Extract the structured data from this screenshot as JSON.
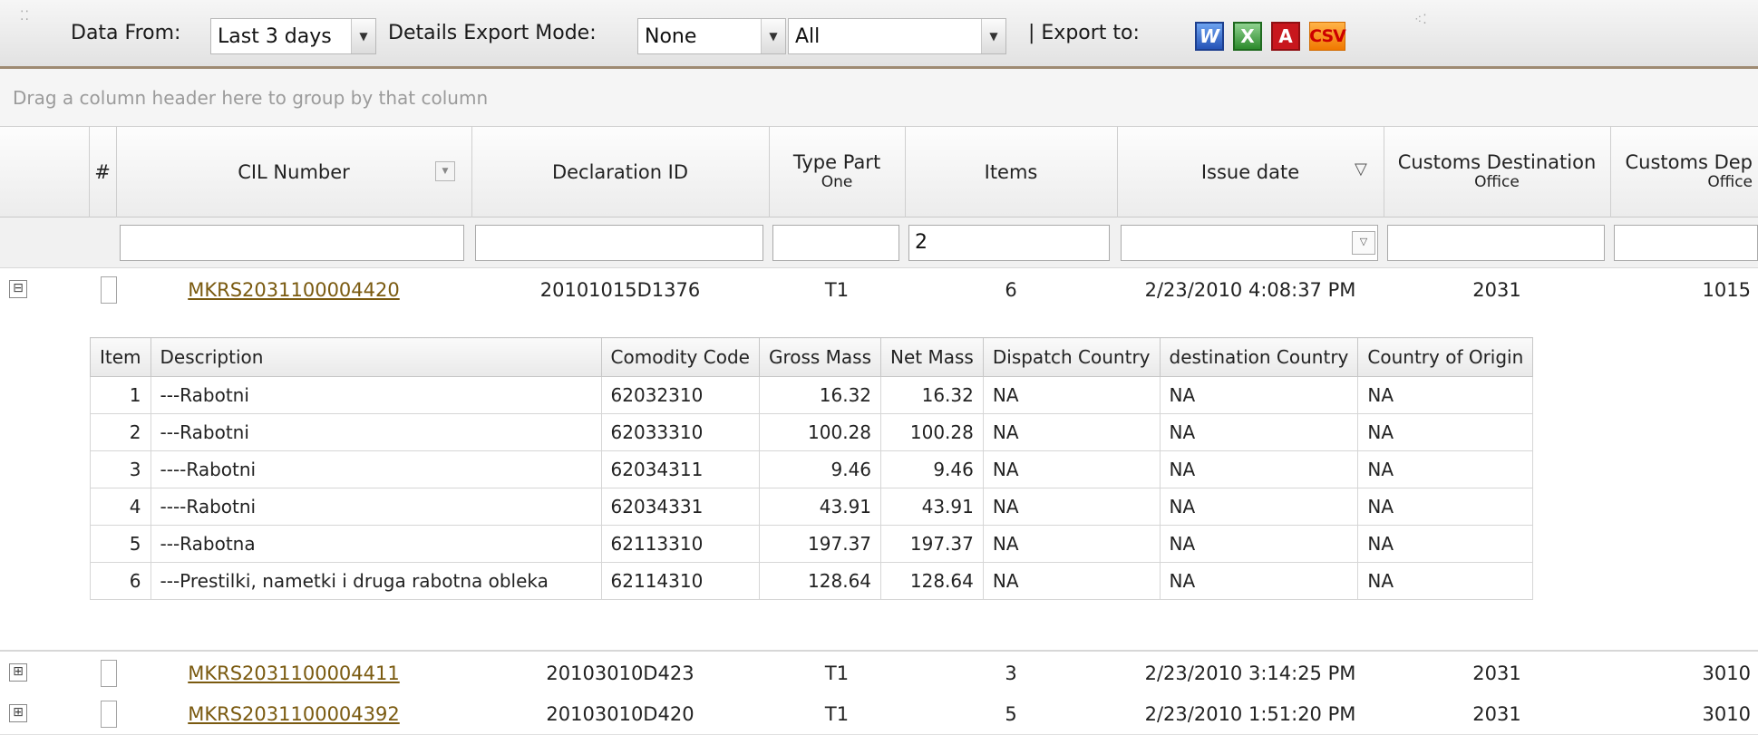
{
  "toolbar": {
    "data_from_label": "Data From:",
    "data_from_value": "Last 3 days",
    "export_mode_label": "Details Export Mode:",
    "export_mode_value": "None",
    "scope_value": "All",
    "export_to_label": "| Export to:",
    "word_glyph": "W",
    "excel_glyph": "X",
    "pdf_glyph": "A",
    "csv_glyph": "CSV"
  },
  "group_panel": {
    "text": "Drag a column header here to group by that column"
  },
  "columns": {
    "num": "#",
    "cil": "CIL Number",
    "decl": "Declaration ID",
    "type_line1": "Type Part",
    "type_line2": "One",
    "items": "Items",
    "issue": "Issue date",
    "cdest_line1": "Customs Destination",
    "cdest_line2": "Office",
    "cdep_line1": "Customs Dep",
    "cdep_line2": "Office"
  },
  "filters": {
    "items_value": "2"
  },
  "rows": [
    {
      "toggle": "⊟",
      "cil": "MKRS2031100004420",
      "decl": "20101015D1376",
      "type": "T1",
      "items": "6",
      "issue": "2/23/2010 4:08:37 PM",
      "cdest": "2031",
      "cdep": "1015"
    },
    {
      "toggle": "⊞",
      "cil": "MKRS2031100004411",
      "decl": "20103010D423",
      "type": "T1",
      "items": "3",
      "issue": "2/23/2010 3:14:25 PM",
      "cdest": "2031",
      "cdep": "3010"
    },
    {
      "toggle": "⊞",
      "cil": "MKRS2031100004392",
      "decl": "20103010D420",
      "type": "T1",
      "items": "5",
      "issue": "2/23/2010 1:51:20 PM",
      "cdest": "2031",
      "cdep": "3010"
    }
  ],
  "detail": {
    "headers": [
      "Item",
      "Description",
      "Comodity Code",
      "Gross Mass",
      "Net Mass",
      "Dispatch Country",
      "destination Country",
      "Country of Origin"
    ],
    "rows": [
      [
        "1",
        "---Rabotni",
        "62032310",
        "16.32",
        "16.32",
        "NA",
        "NA",
        "NA"
      ],
      [
        "2",
        "---Rabotni",
        "62033310",
        "100.28",
        "100.28",
        "NA",
        "NA",
        "NA"
      ],
      [
        "3",
        "----Rabotni",
        "62034311",
        "9.46",
        "9.46",
        "NA",
        "NA",
        "NA"
      ],
      [
        "4",
        "----Rabotni",
        "62034331",
        "43.91",
        "43.91",
        "NA",
        "NA",
        "NA"
      ],
      [
        "5",
        "---Rabotna",
        "62113310",
        "197.37",
        "197.37",
        "NA",
        "NA",
        "NA"
      ],
      [
        "6",
        "---Prestilki, nametki i druga rabotna obleka",
        "62114310",
        "128.64",
        "128.64",
        "NA",
        "NA",
        "NA"
      ]
    ]
  }
}
